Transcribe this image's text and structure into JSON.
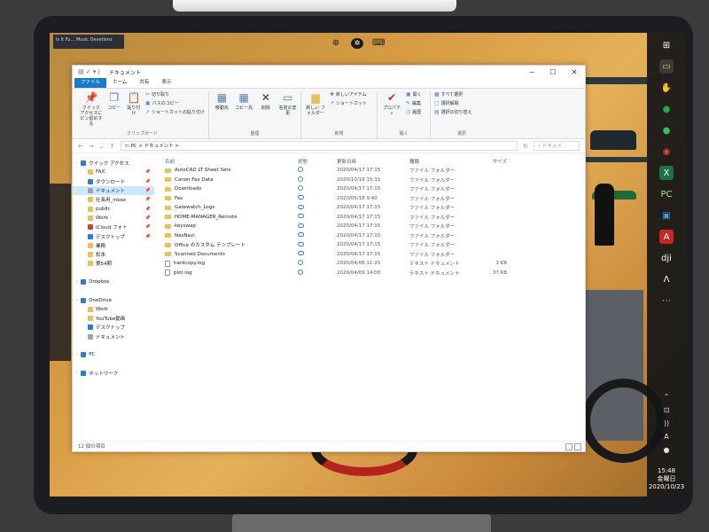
{
  "window": {
    "title": "ドキュメント",
    "controls": [
      "─",
      "☐",
      "✕"
    ]
  },
  "ribbon_tabs": [
    "ファイル",
    "ホーム",
    "共有",
    "表示"
  ],
  "ribbon": {
    "clipboard": {
      "pin": "クイック アクセスにピン留めする",
      "copy": "コピー",
      "paste": "貼り付け",
      "cut": "切り取り",
      "copy_path": "パスのコピー",
      "paste_shortcut": "ショートカットの貼り付け",
      "label": "クリップボード"
    },
    "organize": {
      "move_to": "移動先",
      "copy_to": "コピー先",
      "delete": "削除",
      "rename": "名前の変更",
      "label": "整理"
    },
    "new": {
      "new_folder": "新しい フォルダー",
      "new_item": "新しいアイテム",
      "shortcut": "ショートカット",
      "label": "新規"
    },
    "open": {
      "properties": "プロパティ",
      "open": "開く",
      "edit": "編集",
      "history": "履歴",
      "label": "開く"
    },
    "select": {
      "select_all": "すべて選択",
      "select_none": "選択解除",
      "invert": "選択の切り替え",
      "label": "選択"
    }
  },
  "address": {
    "path": "PC > ドキュメント >",
    "search_placeholder": "ドキュメ..."
  },
  "nav": {
    "items": [
      {
        "label": "クイック アクセス",
        "icon": "star-icon",
        "color": "#2f7bd1",
        "indent": 0,
        "pin": ""
      },
      {
        "label": "FAX",
        "icon": "folder-icon",
        "color": "#e8c158",
        "indent": 1,
        "pin": "📌"
      },
      {
        "label": "ダウンロード",
        "icon": "download-icon",
        "color": "#2f7bd1",
        "indent": 1,
        "pin": "📌"
      },
      {
        "label": "ドキュメント",
        "icon": "document-icon",
        "color": "#9aa6b4",
        "indent": 1,
        "pin": "📌",
        "selected": true
      },
      {
        "label": "社長用_inbox",
        "icon": "folder-icon",
        "color": "#e8c158",
        "indent": 1,
        "pin": "📌"
      },
      {
        "label": "public",
        "icon": "folder-icon",
        "color": "#e8c158",
        "indent": 1,
        "pin": "📌"
      },
      {
        "label": "Work",
        "icon": "folder-icon",
        "color": "#e8c158",
        "indent": 1,
        "pin": "📌"
      },
      {
        "label": "iCloud フォト",
        "icon": "icloud-icon",
        "color": "#c04a3a",
        "indent": 1,
        "pin": "📌"
      },
      {
        "label": "デスクトップ",
        "icon": "desktop-icon",
        "color": "#2f7bd1",
        "indent": 1,
        "pin": "📌"
      },
      {
        "label": "業務",
        "icon": "folder-icon",
        "color": "#e8c158",
        "indent": 1,
        "pin": ""
      },
      {
        "label": "松本",
        "icon": "folder-icon",
        "color": "#e8c158",
        "indent": 1,
        "pin": ""
      },
      {
        "label": "第54期",
        "icon": "folder-icon",
        "color": "#e8c158",
        "indent": 1,
        "pin": ""
      },
      {
        "label": "",
        "icon": "",
        "color": "",
        "indent": 0,
        "pin": ""
      },
      {
        "label": "Dropbox",
        "icon": "dropbox-icon",
        "color": "#2f7bd1",
        "indent": 0,
        "pin": ""
      },
      {
        "label": "",
        "icon": "",
        "color": "",
        "indent": 0,
        "pin": ""
      },
      {
        "label": "OneDrive",
        "icon": "onedrive-icon",
        "color": "#2f7bd1",
        "indent": 0,
        "pin": ""
      },
      {
        "label": "Work",
        "icon": "folder-icon",
        "color": "#e8c158",
        "indent": 1,
        "pin": ""
      },
      {
        "label": "YouTube動画",
        "icon": "folder-icon",
        "color": "#e8c158",
        "indent": 1,
        "pin": ""
      },
      {
        "label": "デスクトップ",
        "icon": "desktop-icon",
        "color": "#2f7bd1",
        "indent": 1,
        "pin": ""
      },
      {
        "label": "ドキュメント",
        "icon": "document-icon",
        "color": "#9aa6b4",
        "indent": 1,
        "pin": ""
      },
      {
        "label": "",
        "icon": "",
        "color": "",
        "indent": 0,
        "pin": ""
      },
      {
        "label": "PC",
        "icon": "pc-icon",
        "color": "#2f7bd1",
        "indent": 0,
        "pin": ""
      },
      {
        "label": "",
        "icon": "",
        "color": "",
        "indent": 0,
        "pin": ""
      },
      {
        "label": "ネットワーク",
        "icon": "network-icon",
        "color": "#2f7bd1",
        "indent": 0,
        "pin": ""
      }
    ]
  },
  "files": {
    "columns": {
      "name": "名前",
      "status": "状態",
      "date": "更新日時",
      "type": "種類",
      "size": "サイズ"
    },
    "rows": [
      {
        "name": "AutoCAD LT Sheet Sets",
        "kind": "folder",
        "status": "ok",
        "date": "2020/04/17 17:15",
        "type": "ファイル フォルダー",
        "size": ""
      },
      {
        "name": "Canon Fax Data",
        "kind": "folder",
        "status": "ok",
        "date": "2020/10/19 15:31",
        "type": "ファイル フォルダー",
        "size": ""
      },
      {
        "name": "Downloads",
        "kind": "folder",
        "status": "ok",
        "date": "2020/04/17 17:15",
        "type": "ファイル フォルダー",
        "size": ""
      },
      {
        "name": "Fax",
        "kind": "folder",
        "status": "cloud",
        "date": "2020/05/18 9:40",
        "type": "ファイル フォルダー",
        "size": ""
      },
      {
        "name": "Gatewatch_Logs",
        "kind": "folder",
        "status": "cloud",
        "date": "2020/04/17 17:15",
        "type": "ファイル フォルダー",
        "size": ""
      },
      {
        "name": "HOME-MANAGER_Remote",
        "kind": "folder",
        "status": "cloud",
        "date": "2020/04/17 17:15",
        "type": "ファイル フォルダー",
        "size": ""
      },
      {
        "name": "keyswap",
        "kind": "folder",
        "status": "cloud",
        "date": "2020/04/17 17:15",
        "type": "ファイル フォルダー",
        "size": ""
      },
      {
        "name": "NasNavi",
        "kind": "folder",
        "status": "cloud",
        "date": "2020/04/17 17:15",
        "type": "ファイル フォルダー",
        "size": ""
      },
      {
        "name": "Office のカスタム テンプレート",
        "kind": "folder",
        "status": "cloud",
        "date": "2020/04/17 17:15",
        "type": "ファイル フォルダー",
        "size": ""
      },
      {
        "name": "Scanned Documents",
        "kind": "folder",
        "status": "cloud",
        "date": "2020/04/17 17:15",
        "type": "ファイル フォルダー",
        "size": ""
      },
      {
        "name": "hardcopy.log",
        "kind": "file",
        "status": "ok",
        "date": "2020/04/06 11:25",
        "type": "テキスト ドキュメント",
        "size": "3 KB"
      },
      {
        "name": "plot.log",
        "kind": "file",
        "status": "ok",
        "date": "2020/04/09 14:00",
        "type": "テキスト ドキュメント",
        "size": "37 KB"
      }
    ]
  },
  "statusbar": {
    "count": "12 個の項目"
  },
  "desktop": {
    "poster_text": "Is It Fu... Music Devotions",
    "taskbar_icons": [
      {
        "name": "windows-start-icon",
        "glyph": "⊞",
        "color": "#ffffff",
        "bg": "transparent"
      },
      {
        "name": "file-explorer-icon",
        "glyph": "▭",
        "color": "#f0c040",
        "bg": "#3a3a3a"
      },
      {
        "name": "hand-icon",
        "glyph": "✋",
        "color": "#f5d27a",
        "bg": "transparent"
      },
      {
        "name": "app-green-circle-icon",
        "glyph": "●",
        "color": "#2aa84a",
        "bg": "transparent"
      },
      {
        "name": "app-green-circle2-icon",
        "glyph": "●",
        "color": "#3bbd5a",
        "bg": "transparent"
      },
      {
        "name": "chrome-icon",
        "glyph": "◉",
        "color": "#e84a3a",
        "bg": "transparent"
      },
      {
        "name": "excel-icon",
        "glyph": "X",
        "color": "#ffffff",
        "bg": "#1e7145"
      },
      {
        "name": "app-green-text-icon",
        "glyph": "PC",
        "color": "#9ef08a",
        "bg": "transparent"
      },
      {
        "name": "app-blue-window-icon",
        "glyph": "▣",
        "color": "#4a9ae8",
        "bg": "transparent"
      },
      {
        "name": "autocad-icon",
        "glyph": "A",
        "color": "#ffffff",
        "bg": "#c8281e"
      },
      {
        "name": "dji-icon",
        "glyph": "dji",
        "color": "#ffffff",
        "bg": "transparent"
      },
      {
        "name": "app-triangle-icon",
        "glyph": "Λ",
        "color": "#ffffff",
        "bg": "transparent"
      },
      {
        "name": "app-dotted-icon",
        "glyph": "⋯",
        "color": "#bbbbbb",
        "bg": "transparent"
      }
    ],
    "tray": [
      "⌃",
      "⊡",
      "))",
      "A",
      "●"
    ],
    "clock": {
      "time": "15:48",
      "day": "金曜日",
      "date": "2020/10/23"
    }
  }
}
